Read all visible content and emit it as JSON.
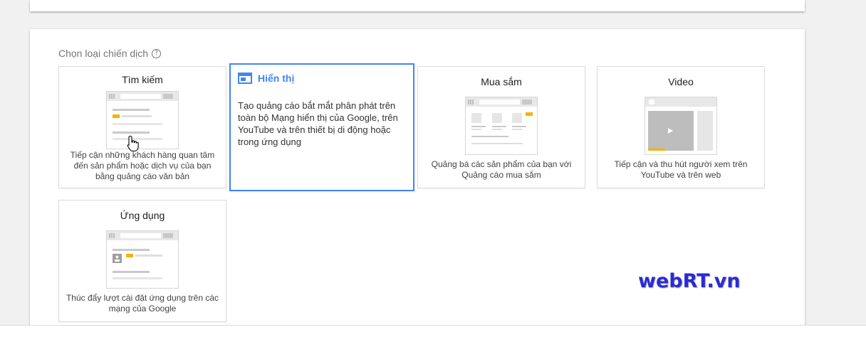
{
  "section": {
    "label": "Chọn loại chiến dịch",
    "help_icon": "help-circle-icon"
  },
  "campaign_types": [
    {
      "id": "search",
      "title": "Tìm kiếm",
      "description": "Tiếp cận những khách hàng quan tâm đến sản phẩm hoặc dịch vụ của bạn bằng quảng cáo văn bản",
      "selected": false
    },
    {
      "id": "display",
      "title": "Hiển thị",
      "description": "Tạo quảng cáo bắt mắt phân phát trên toàn bộ Mạng hiển thị của Google, trên YouTube và trên thiết bị di động hoặc trong ứng dụng",
      "selected": true
    },
    {
      "id": "shopping",
      "title": "Mua sắm",
      "description": "Quảng bá các sản phẩm của bạn với Quảng cáo mua sắm",
      "selected": false
    },
    {
      "id": "video",
      "title": "Video",
      "description": "Tiếp cận và thu hút người xem trên YouTube và trên web",
      "selected": false
    },
    {
      "id": "app",
      "title": "Ứng dụng",
      "description": "Thúc đẩy lượt cài đặt ứng dụng trên các mạng của Google",
      "selected": false
    }
  ],
  "watermark": "webRT.vn",
  "colors": {
    "accent": "#4285f4",
    "ad_highlight": "#f4b400",
    "watermark": "#2b2bd6"
  }
}
